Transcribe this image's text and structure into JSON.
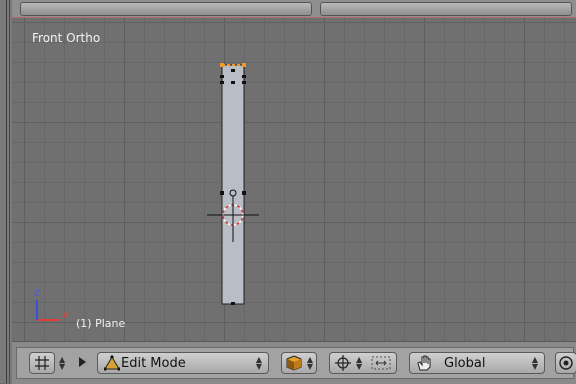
{
  "viewport": {
    "view_label": "Front Ortho",
    "object_label": "(1) Plane",
    "axis_labels": {
      "z": "z",
      "x": "x"
    },
    "grid_color": "#5f5f5f",
    "background_color": "#707070",
    "mesh_color": "#b9bdc6",
    "selected_vertex_color": "#f39a2b"
  },
  "header": {
    "mode_label": "Edit Mode",
    "orientation_label": "Global",
    "icons": [
      "grid-icon",
      "triangle-expand-icon",
      "edit-mode-icon",
      "shading-cube-icon",
      "pivot-icon",
      "manipulator-icon",
      "hand-icon",
      "proportional-icon"
    ]
  }
}
